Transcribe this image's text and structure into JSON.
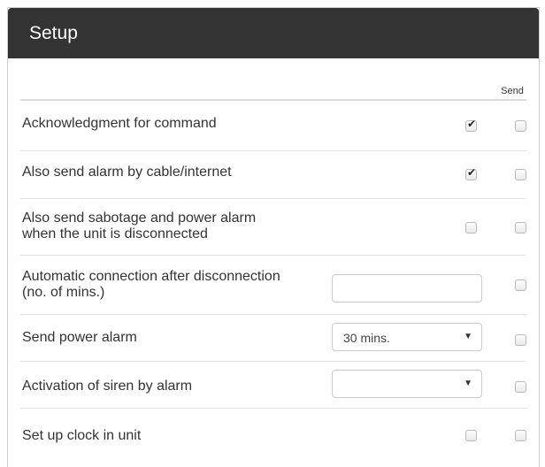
{
  "header": {
    "title": "Setup"
  },
  "columns": {
    "send": "Send"
  },
  "rows": [
    {
      "label_lines": [
        "Acknowledgment for command"
      ],
      "control": "checkbox",
      "checked": true,
      "send_checked": false
    },
    {
      "label_lines": [
        "Also send alarm by cable/internet"
      ],
      "control": "checkbox",
      "checked": true,
      "send_checked": false
    },
    {
      "label_lines": [
        "Also send sabotage and power alarm",
        "when the unit is disconnected"
      ],
      "control": "checkbox",
      "checked": false,
      "send_checked": false
    },
    {
      "label_lines": [
        "Automatic connection after disconnection",
        "(no. of mins.)"
      ],
      "control": "text",
      "value": "",
      "send_checked": false
    },
    {
      "label_lines": [
        "Send power alarm"
      ],
      "control": "select",
      "value": "30 mins.",
      "send_checked": false
    },
    {
      "label_lines": [
        "Activation of siren by alarm"
      ],
      "control": "select",
      "value": "",
      "send_checked": false
    },
    {
      "label_lines": [
        "Set up clock in unit"
      ],
      "control": "checkbox",
      "checked": false,
      "send_checked": false
    }
  ],
  "icons": {
    "checkmark": "check-icon",
    "dropdown": "caret-down-icon"
  }
}
